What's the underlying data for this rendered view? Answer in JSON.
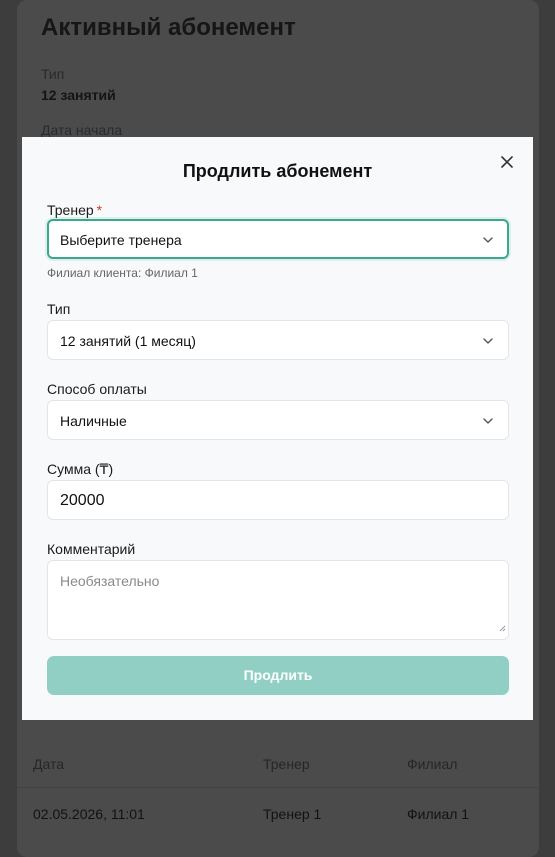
{
  "background": {
    "title": "Активный абонемент",
    "type_label": "Тип",
    "type_value": "12 занятий",
    "start_label": "Дата начала",
    "table": {
      "headers": [
        "Дата",
        "Тренер",
        "Филиал"
      ],
      "rows": [
        [
          "02.05.2026, 11:01",
          "Тренер 1",
          "Филиал 1"
        ]
      ]
    }
  },
  "modal": {
    "title": "Продлить абонемент",
    "trainer": {
      "label": "Тренер",
      "required_mark": "*",
      "value": "Выберите тренера",
      "hint": "Филиал клиента: Филиал 1"
    },
    "type": {
      "label": "Тип",
      "value": "12 занятий (1 месяц)"
    },
    "payment": {
      "label": "Способ оплаты",
      "value": "Наличные"
    },
    "amount": {
      "label": "Сумма (₸)",
      "value": "20000"
    },
    "comment": {
      "label": "Комментарий",
      "placeholder": "Необязательно"
    },
    "submit_label": "Продлить"
  },
  "colors": {
    "accent": "#3aa88c",
    "submit_disabled": "#91cfc4",
    "required": "#dd3333"
  }
}
